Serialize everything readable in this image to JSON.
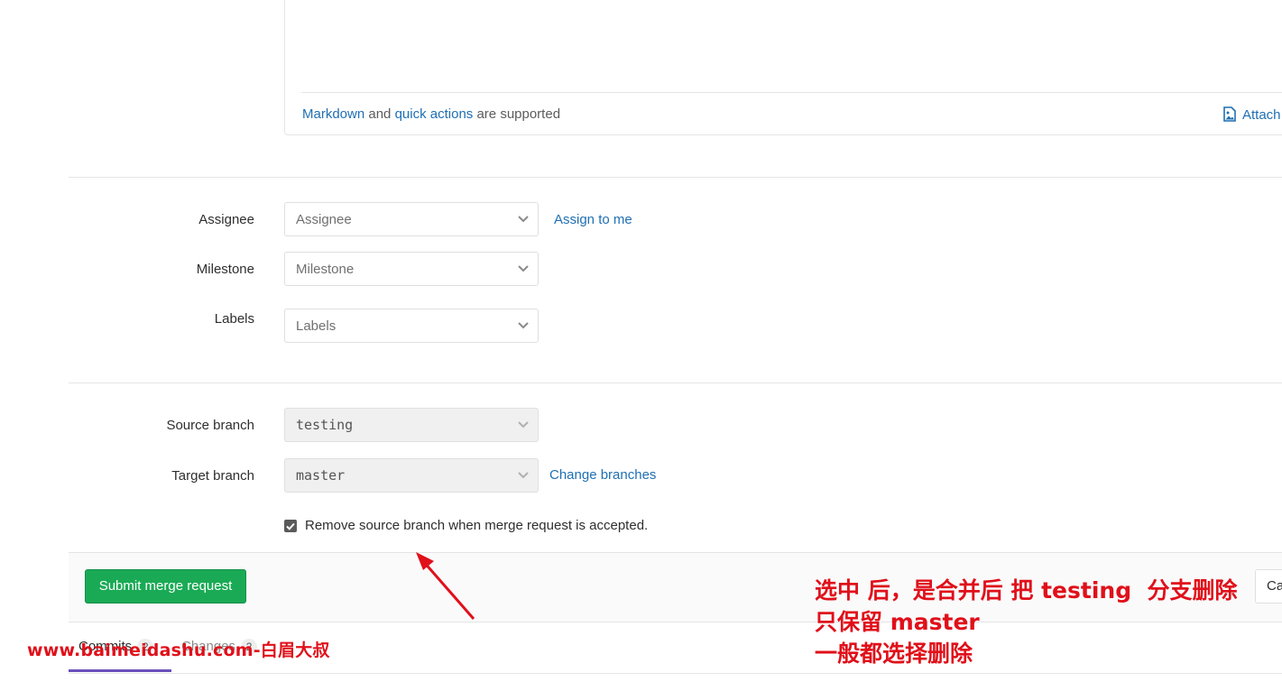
{
  "editor": {
    "markdown_link": "Markdown",
    "and_text": "and",
    "quick_actions_link": "quick actions",
    "supported_text": "are supported",
    "attach_label": "Attach"
  },
  "fields": {
    "assignee": {
      "label": "Assignee",
      "placeholder": "Assignee",
      "side_link": "Assign to me"
    },
    "milestone": {
      "label": "Milestone",
      "placeholder": "Milestone"
    },
    "labels": {
      "label": "Labels",
      "placeholder": "Labels"
    },
    "source_branch": {
      "label": "Source branch",
      "value": "testing"
    },
    "target_branch": {
      "label": "Target branch",
      "value": "master",
      "side_link": "Change branches"
    },
    "remove_source": {
      "label": "Remove source branch when merge request is accepted.",
      "checked": true
    }
  },
  "actions": {
    "submit_label": "Submit merge request",
    "cancel_label": "Cancel"
  },
  "tabs": [
    {
      "label": "Commits",
      "count": "2",
      "active": true
    },
    {
      "label": "Changes",
      "count": "2",
      "active": false
    }
  ],
  "overlay": {
    "watermark": "www.baimeidashu.com-白眉大叔",
    "annotation_line1": "选中 后，是合并后 把 testing  分支删除",
    "annotation_line2": "只保留 master",
    "annotation_line3": "一般都选择删除",
    "annotation_color": "#e0101a"
  },
  "colors": {
    "link": "#1f6fb3",
    "submit_bg": "#1aaa55",
    "tab_active": "#6b4fbb"
  }
}
